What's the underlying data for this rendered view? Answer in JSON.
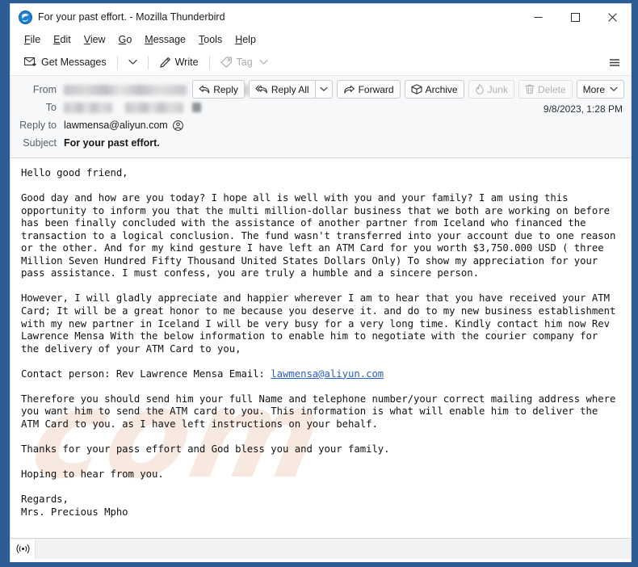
{
  "window": {
    "title": "For your past effort. - Mozilla Thunderbird",
    "app_icon": "thunderbird-icon",
    "controls": {
      "minimize": "minimize-icon",
      "maximize": "maximize-icon",
      "close": "close-icon"
    }
  },
  "menubar": {
    "items": [
      {
        "label": "File",
        "accesskey": "F"
      },
      {
        "label": "Edit",
        "accesskey": "E"
      },
      {
        "label": "View",
        "accesskey": "V"
      },
      {
        "label": "Go",
        "accesskey": "G"
      },
      {
        "label": "Message",
        "accesskey": "M"
      },
      {
        "label": "Tools",
        "accesskey": "T"
      },
      {
        "label": "Help",
        "accesskey": "H"
      }
    ]
  },
  "toolbar": {
    "get_messages": "Get Messages",
    "get_messages_icon": "envelope-download-icon",
    "get_messages_caret": "chevron-down-icon",
    "write": "Write",
    "write_icon": "pencil-icon",
    "tag": "Tag",
    "tag_icon": "tag-icon",
    "tag_caret": "chevron-down-icon",
    "app_menu": "hamburger-menu-icon"
  },
  "header": {
    "labels": {
      "from": "From",
      "to": "To",
      "reply_to": "Reply to",
      "subject": "Subject"
    },
    "from_value": "",
    "to_value": "",
    "reply_to_value": "lawmensa@aliyun.com",
    "reply_to_icon": "contact-card-icon",
    "subject_value": "For your past effort.",
    "date": "9/8/2023, 1:28 PM",
    "actions": {
      "reply": "Reply",
      "reply_icon": "reply-arrow-icon",
      "reply_all": "Reply All",
      "reply_all_icon": "reply-all-arrow-icon",
      "reply_all_caret": "chevron-down-icon",
      "forward": "Forward",
      "forward_icon": "forward-arrow-icon",
      "archive": "Archive",
      "archive_icon": "archive-box-icon",
      "junk": "Junk",
      "junk_icon": "flame-icon",
      "delete": "Delete",
      "delete_icon": "trash-icon",
      "more": "More",
      "more_caret": "chevron-down-icon"
    }
  },
  "body": {
    "watermark": "com",
    "text_before_link": "Hello good friend,\n\nGood day and how are you today? I hope all is well with you and your family? I am using this\nopportunity to inform you that the multi million-dollar business that we both are working on before\nhas been finally concluded with the assistance of another partner from Iceland who financed the\ntransaction to a logical conclusion. The fund wasn't transferred into your account due to one reason\nor the other. And for my kind gesture I have left an ATM Card for you worth $3,750.000 USD ( three\nMillion Seven Hundred Fifty Thousand United States Dollars Only) To show my appreciation for your\npass assistance. I must confess, you are truly a humble and a sincere person.\n\nHowever, I will gladly appreciate and happier wherever I am to hear that you have received your ATM\nCard; It will be a great honor to me because you deserve it. and do to my new business establishment\nwith my new partner in Iceland I will be very busy for a very long time. Kindly contact him now Rev\nLawrence Mensa With the below information to enable him to negotiate with the courier company for\nthe delivery of your ATM Card to you,\n\nContact person: Rev Lawrence Mensa Email: ",
    "link_text": "lawmensa@aliyun.com",
    "text_after_link": "\n\nTherefore you should send him your full Name and telephone number/your correct mailing address where\nyou want him to send the ATM card to you. This information is what will enable him to deliver the\nATM Card to you. as I have left instructions on your behalf.\n\nThanks for your pass effort and God bless you and your family.\n\nHoping to hear from you.\n\nRegards,\nMrs. Precious Mpho"
  },
  "statusbar": {
    "icon": "broadcast-signal-icon",
    "text": ""
  },
  "colors": {
    "frame": "#2d5b94",
    "header_bg": "#f7f8f9",
    "link": "#2b5fc4",
    "watermark": "#eccab6"
  }
}
